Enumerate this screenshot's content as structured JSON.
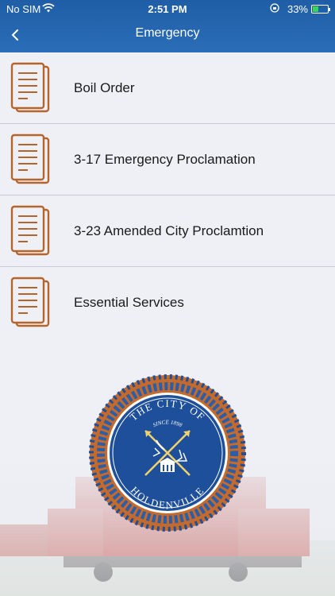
{
  "status": {
    "carrier": "No SIM",
    "time": "2:51 PM",
    "battery": "33%",
    "battery_level": 0.33
  },
  "nav": {
    "title": "Emergency"
  },
  "items": [
    {
      "label": "Boil Order"
    },
    {
      "label": "3-17 Emergency Proclamation"
    },
    {
      "label": "3-23 Amended City Proclamtion"
    },
    {
      "label": "Essential Services"
    }
  ],
  "seal": {
    "line1": "THE CITY OF",
    "line2": "SINCE 1898",
    "line3": "HOLDENVILLE"
  },
  "colors": {
    "nav_bg": "#2b6db8",
    "icon": "#b5642b",
    "seal_blue": "#1e4f9a",
    "seal_orange": "#c46a2c"
  }
}
